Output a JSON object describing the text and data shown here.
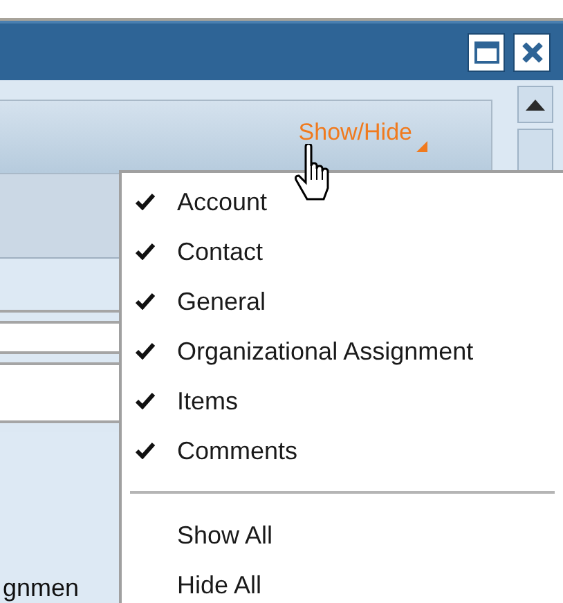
{
  "panel": {
    "toggle_link": "Show/Hide",
    "partial_label": "gnmen"
  },
  "menu": {
    "items": [
      {
        "label": "Account",
        "checked": true
      },
      {
        "label": "Contact",
        "checked": true
      },
      {
        "label": "General",
        "checked": true
      },
      {
        "label": "Organizational Assignment",
        "checked": true
      },
      {
        "label": "Items",
        "checked": true
      },
      {
        "label": "Comments",
        "checked": true
      }
    ],
    "actions": [
      "Show All",
      "Hide All"
    ]
  }
}
